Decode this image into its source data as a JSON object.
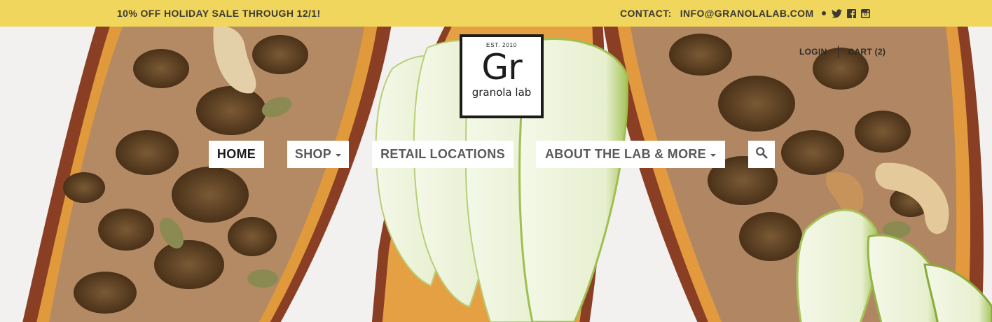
{
  "announcement": {
    "promo": "10% OFF HOLIDAY SALE THROUGH 12/1!",
    "contact_label": "CONTACT:",
    "contact_email": "INFO@GRANOLALAB.COM",
    "social_icons": [
      "twitter-icon",
      "facebook-icon",
      "instagram-icon"
    ]
  },
  "logo": {
    "established": "EST. 2010",
    "mark": "Gr",
    "name": "granola lab"
  },
  "account": {
    "login": "LOGIN",
    "cart": "CART (2)"
  },
  "nav": {
    "home": "HOME",
    "shop": "SHOP",
    "retail": "RETAIL LOCATIONS",
    "about": "ABOUT THE LAB & MORE",
    "search_icon": "search-icon"
  },
  "colors": {
    "announcement_bg": "#f0d65c",
    "text_dark": "#3b3a36",
    "nav_bg": "#ffffff"
  }
}
